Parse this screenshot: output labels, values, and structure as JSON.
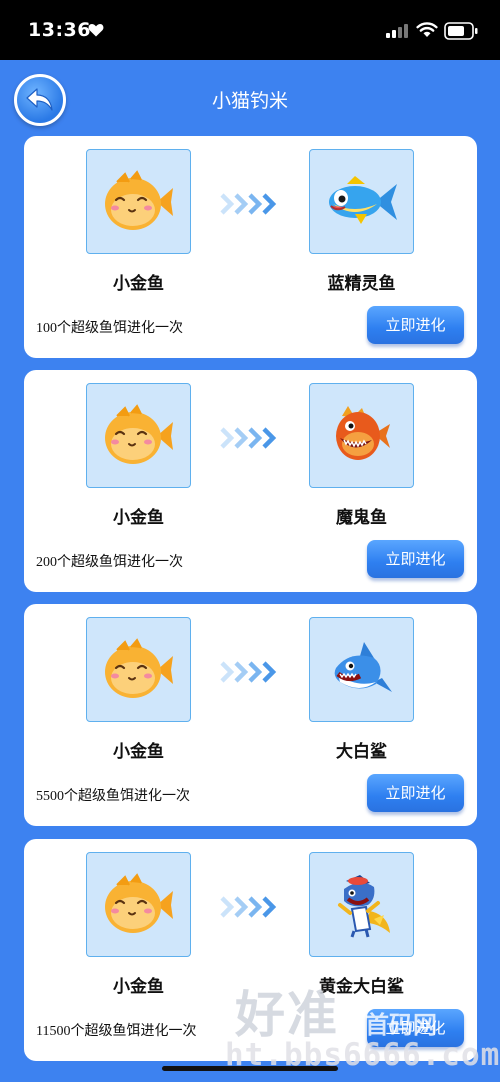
{
  "status_bar": {
    "time": "13:36"
  },
  "header": {
    "title": "小猫钓米"
  },
  "cards": [
    {
      "from_name": "小金鱼",
      "to_name": "蓝精灵鱼",
      "cost_text": "100个超级鱼饵进化一次",
      "button_label": "立即进化",
      "to_fish_icon": "blue-sprite-fish"
    },
    {
      "from_name": "小金鱼",
      "to_name": "魔鬼鱼",
      "cost_text": "200个超级鱼饵进化一次",
      "button_label": "立即进化",
      "to_fish_icon": "devil-fish"
    },
    {
      "from_name": "小金鱼",
      "to_name": "大白鲨",
      "cost_text": "5500个超级鱼饵进化一次",
      "button_label": "立即进化",
      "to_fish_icon": "great-white-shark"
    },
    {
      "from_name": "小金鱼",
      "to_name": "黄金大白鲨",
      "cost_text": "11500个超级鱼饵进化一次",
      "button_label": "立即进化",
      "to_fish_icon": "golden-great-white-shark"
    }
  ],
  "watermark": {
    "main": "好准",
    "sub": "首码网",
    "url": "ht.bbs6666.com"
  },
  "colors": {
    "background": "#3d82f0",
    "card": "#ffffff",
    "fish_box": "#cfe6fb",
    "button": "#2e7ff0"
  }
}
